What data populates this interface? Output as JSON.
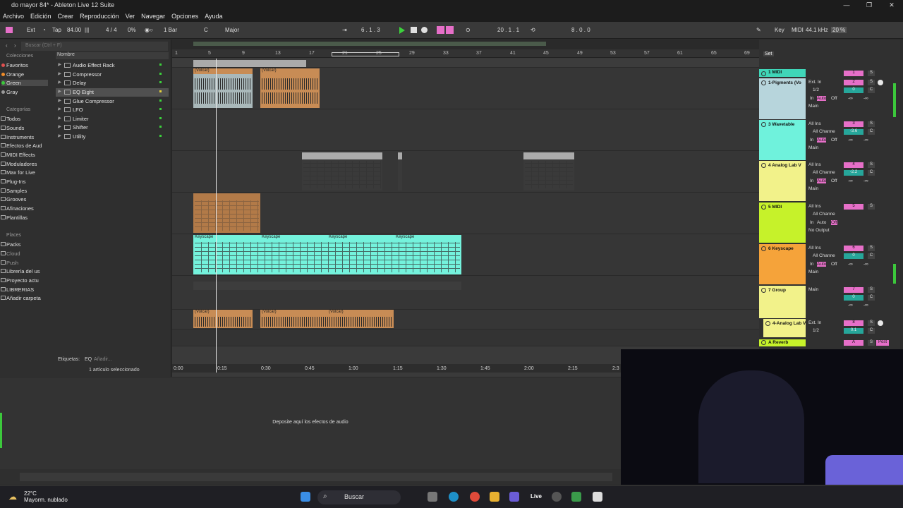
{
  "window": {
    "title": "do mayor 84* - Ableton Live 12 Suite"
  },
  "menu": [
    "Archivo",
    "Edición",
    "Crear",
    "Reproducción",
    "Ver",
    "Navegar",
    "Opciones",
    "Ayuda"
  ],
  "control": {
    "ext": "Ext",
    "tap": "Tap",
    "tempo": "84.00",
    "signature": "4 / 4",
    "groove": "0%",
    "quantize": "1 Bar",
    "key": "C",
    "scale": "Major",
    "position": "6 . 1 . 3",
    "loop_start": "20 . 1 . 1",
    "loop_length": "8 . 0 . 0",
    "key_map": "Key",
    "midi": "MIDI",
    "sample_rate": "44.1 kHz",
    "cpu": "20 %"
  },
  "browser": {
    "search_placeholder": "Buscar (Ctrl + F)",
    "collections_header": "Colecciones",
    "collections": [
      {
        "label": "Favoritos",
        "color": "#e05050"
      },
      {
        "label": "Orange",
        "color": "#f08c28"
      },
      {
        "label": "Green",
        "color": "#3cc83c"
      },
      {
        "label": "Gray",
        "color": "#9a9a9a"
      }
    ],
    "categories_header": "Categorías",
    "categories": [
      "Todos",
      "Sounds",
      "Instruments",
      "Efectos de Aud",
      "MIDI Effects",
      "Moduladores",
      "Max for Live",
      "Plug-Ins",
      "Samples",
      "Grooves",
      "Afinaciones",
      "Plantillas"
    ],
    "places_header": "Places",
    "places": [
      "Packs",
      "Cloud",
      "Push",
      "Librería del us",
      "Proyecto actu",
      "LIBRERIAS",
      "Añadir carpeta"
    ],
    "name_header": "Nombre",
    "items": [
      "Audio Effect Rack",
      "Compressor",
      "Delay",
      "EQ Eight",
      "Glue Compressor",
      "LFO",
      "Limiter",
      "Shifter",
      "Utility"
    ],
    "tags_label": "Etiquetas:",
    "tag_eq": "EQ",
    "tag_add": "Añadir...",
    "selection": "1 artículo seleccionado"
  },
  "arrangement": {
    "bars": [
      "1",
      "5",
      "9",
      "13",
      "17",
      "21",
      "25",
      "29",
      "33",
      "37",
      "41",
      "45",
      "49",
      "53",
      "57",
      "61",
      "65",
      "69"
    ],
    "time": [
      "0:00",
      "0:15",
      "0:30",
      "0:45",
      "1:00",
      "1:15",
      "1:30",
      "1:45",
      "2:00",
      "2:15",
      "2:3"
    ],
    "clips": {
      "volcar": "(Volcar)",
      "keyscape": "Keyscape"
    }
  },
  "mixer": {
    "set": "Set",
    "tracks": [
      {
        "name": "1 MIDI",
        "color": "#3fd6b8",
        "num": "1",
        "in": "",
        "ch": "",
        "mon": "",
        "out": ""
      },
      {
        "name": "1-Pigments (Vo",
        "color": "#b7d5dc",
        "num": "2",
        "in": "Ext. In",
        "ch": "1/2",
        "mon": "Auto",
        "out": "Main",
        "vol": "0",
        "pan": "C"
      },
      {
        "name": "3 Wavetable",
        "color": "#6ff2dc",
        "num": "3",
        "in": "All Ins",
        "ch": "All Channe",
        "mon": "Auto",
        "out": "Main",
        "vol": "-3.6",
        "pan": "C"
      },
      {
        "name": "4 Analog Lab V",
        "color": "#f2f28a",
        "num": "4",
        "in": "All Ins",
        "ch": "All Channe",
        "mon": "Auto",
        "out": "Main",
        "vol": "-2.2",
        "pan": "C"
      },
      {
        "name": "5 MIDI",
        "color": "#c6f22a",
        "num": "5",
        "in": "All Ins",
        "ch": "All Channe",
        "mon": "Auto",
        "out": "No Output",
        "vol": "",
        "pan": ""
      },
      {
        "name": "6 Keyscape",
        "color": "#f5a33a",
        "num": "6",
        "in": "All Ins",
        "ch": "All Channe",
        "mon": "Auto",
        "out": "Main",
        "vol": "0",
        "pan": "C"
      },
      {
        "name": "7 Group",
        "color": "#f2f28a",
        "num": "7",
        "in": "Main",
        "ch": "",
        "mon": "",
        "out": "",
        "vol": "0",
        "pan": "C"
      },
      {
        "name": "4-Analog Lab V",
        "color": "#f2f28a",
        "num": "8",
        "in": "Ext. In",
        "ch": "1/2",
        "mon": "",
        "out": "",
        "vol": "0.1",
        "pan": "C"
      },
      {
        "name": "A Reverb",
        "color": "#c6f22a",
        "num": "A",
        "in": "",
        "ch": "",
        "mon": "",
        "out": "",
        "vol": "",
        "pan": ""
      }
    ],
    "in_label": "In",
    "off_label": "Off",
    "inf": "-∞",
    "s": "S",
    "c": "C",
    "post": "Post"
  },
  "device": {
    "drop_hint": "Deposite aquí los efectos de audio"
  },
  "taskbar": {
    "temp": "22°C",
    "weather": "Mayorm. nublado",
    "search": "Buscar",
    "live": "Live"
  }
}
